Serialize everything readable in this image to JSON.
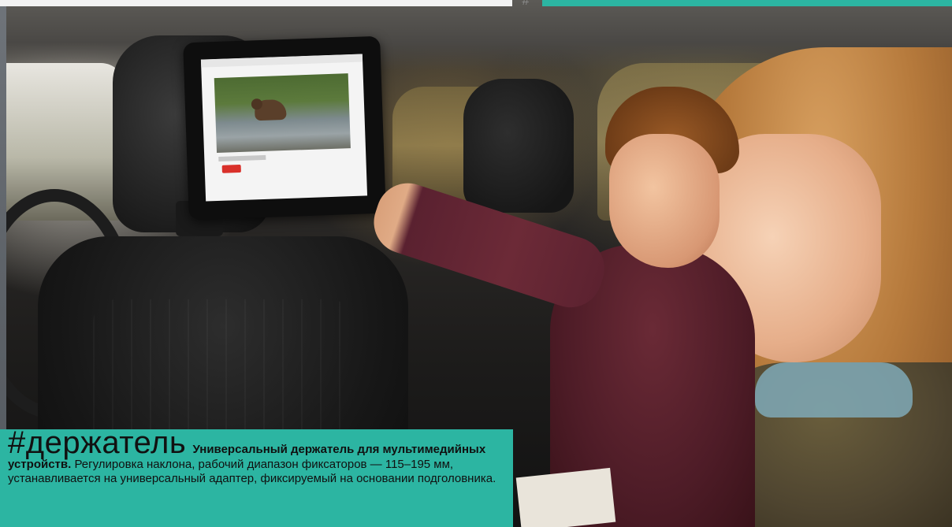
{
  "caption": {
    "hashtag": "#держатель",
    "title": "Универсальный держатель для мультимедийных устройств.",
    "body": "Регулировка наклона, рабочий диапазон фиксаторов — 115–195 мм, устанавливается на универсальный адаптер, фиксируемый на основании подголовника."
  },
  "top_mark": "#",
  "colors": {
    "accent": "#2cb5a2",
    "text": "#101010"
  }
}
